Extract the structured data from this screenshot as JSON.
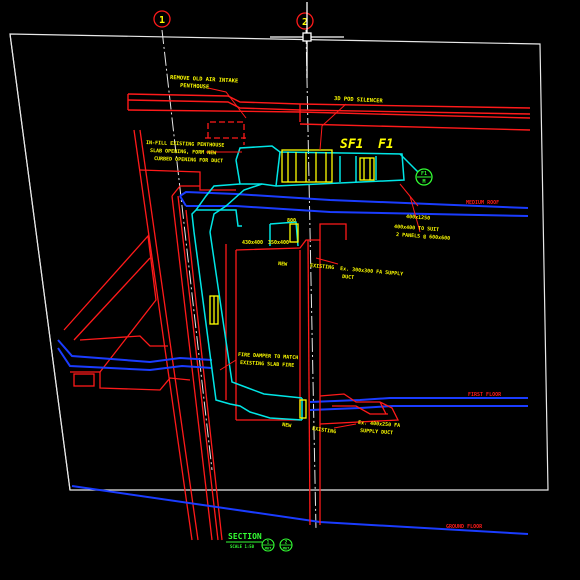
{
  "grid": {
    "line_1": "1",
    "line_2": "2"
  },
  "notes": {
    "remove_air_intake": [
      "REMOVE OLD AIR INTAKE",
      "PENTHOUSE"
    ],
    "silencer": "3D POD SILENCER",
    "infill_slab": [
      "IN-FILL EXISTING PENTHOUSE",
      "SLAB OPENING, FORM NEW",
      "CURBED OPENING FOR DUCT"
    ],
    "sf1": "SF1",
    "f1": "F1",
    "new_1": "NEW",
    "new_2": "NEW",
    "existing": "EXISTING",
    "silencer_tag": "800",
    "dim_430x400": "430x400",
    "dim_350x400": "350x400",
    "dim_400x1250": "400x1250",
    "access_panels": [
      "400x400 TO SUIT",
      "2 PANELS @ 600x600"
    ],
    "ex_supply_upper": [
      "Ex. 300x300 FA SUPPLY",
      "DUCT"
    ],
    "ex_supply_lower": [
      "Ex. 400x250 FA",
      "SUPPLY DUCT"
    ],
    "fire_damper": [
      "FIRE DAMPER TO MATCH",
      "EXISTING SLAB FIRE"
    ],
    "bottom_note_1": "NEW",
    "bottom_note_2": "EXISTING"
  },
  "levels": {
    "roof": "MEDIUM ROOF",
    "first": "FIRST FLOOR",
    "ground": "GROUND FLOOR"
  },
  "equipment_tag": {
    "top": "F1",
    "bottom": "M"
  },
  "section_title": {
    "title": "SECTION",
    "scale": "SCALE 1:50",
    "ref_a": [
      "1",
      "M07"
    ],
    "ref_b": [
      "2",
      "M07"
    ]
  },
  "colors": {
    "background": "#000000",
    "frame": "#e8e8e8",
    "structure": "#ff1a1a",
    "slab": "#1a3cff",
    "duct": "#00e6e6",
    "notes": "#ffff00",
    "grid_marker": "#ff1a1a",
    "tag": "#33ff33",
    "cursor": "#ffffff"
  }
}
